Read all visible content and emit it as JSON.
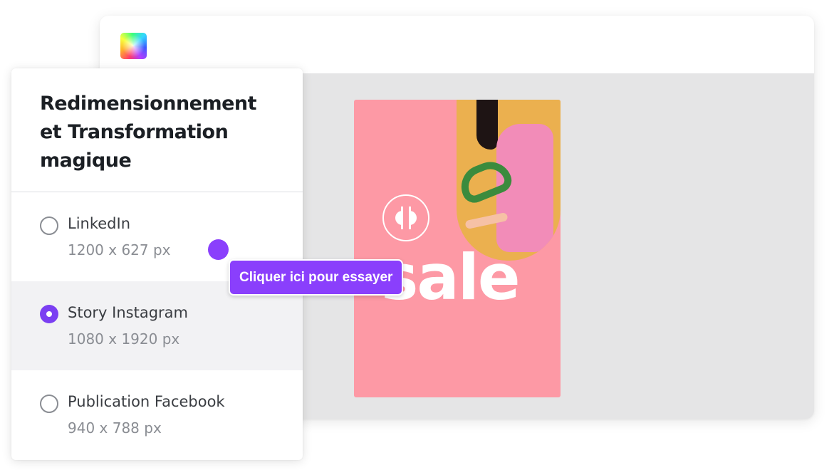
{
  "panel": {
    "title": "Redimensionnement et Transformation magique",
    "options": [
      {
        "name": "LinkedIn",
        "size": "1200 x 627 px",
        "selected": false
      },
      {
        "name": "Story Instagram",
        "size": "1080 x 1920 px",
        "selected": true
      },
      {
        "name": "Publication Facebook",
        "size": "940 x 788 px",
        "selected": false
      }
    ]
  },
  "tooltip": {
    "label": "Cliquer ici pour essayer"
  },
  "design": {
    "headline": "sale",
    "logo": "brand-monogram-icon"
  },
  "editor": {
    "logo": "app-logo-icon"
  },
  "colors": {
    "accent": "#8a3ffc",
    "radio_selected": "#7b3ff2",
    "design_background": "#fd99a5",
    "photo_background": "#ebb04f",
    "canvas_background": "#e5e5e6"
  }
}
